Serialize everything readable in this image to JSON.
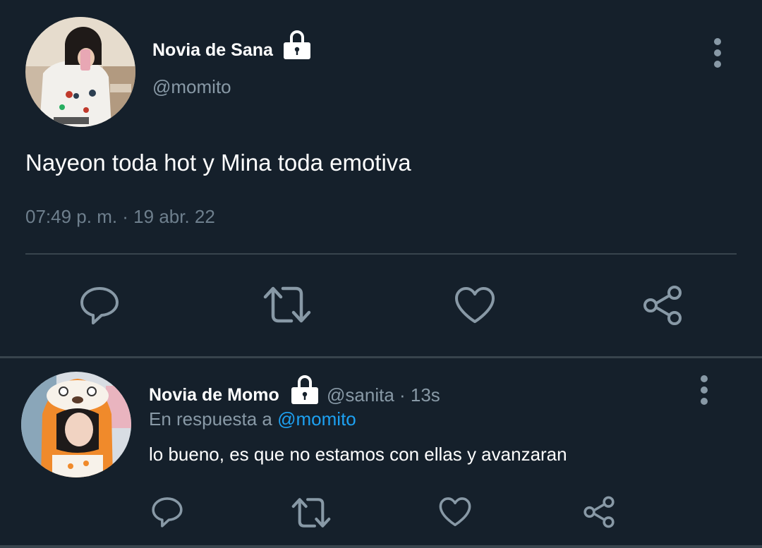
{
  "main_tweet": {
    "display_name": "Novia de Sana",
    "handle": "@momito",
    "text": "Nayeon toda hot y Mina toda emotiva",
    "timestamp": "07:49 p. m. · 19 abr. 22",
    "protected_icon": "lock-icon",
    "menu_icon": "more-vertical-icon"
  },
  "reply_tweet": {
    "display_name": "Novia de Momo",
    "handle": "@sanita",
    "separator": " · ",
    "time_ago": "13s",
    "reply_prefix": "En respuesta a ",
    "reply_to": "@momito",
    "text": "lo bueno, es que no estamos con ellas y avanzaran",
    "protected_icon": "lock-icon",
    "menu_icon": "more-vertical-icon"
  },
  "actions": [
    "reply-icon",
    "retweet-icon",
    "like-icon",
    "share-icon"
  ],
  "colors": {
    "background": "#15202b",
    "primary_text": "#ffffff",
    "secondary_text": "#8899a6",
    "link": "#1da1f2",
    "divider": "#38444d"
  }
}
